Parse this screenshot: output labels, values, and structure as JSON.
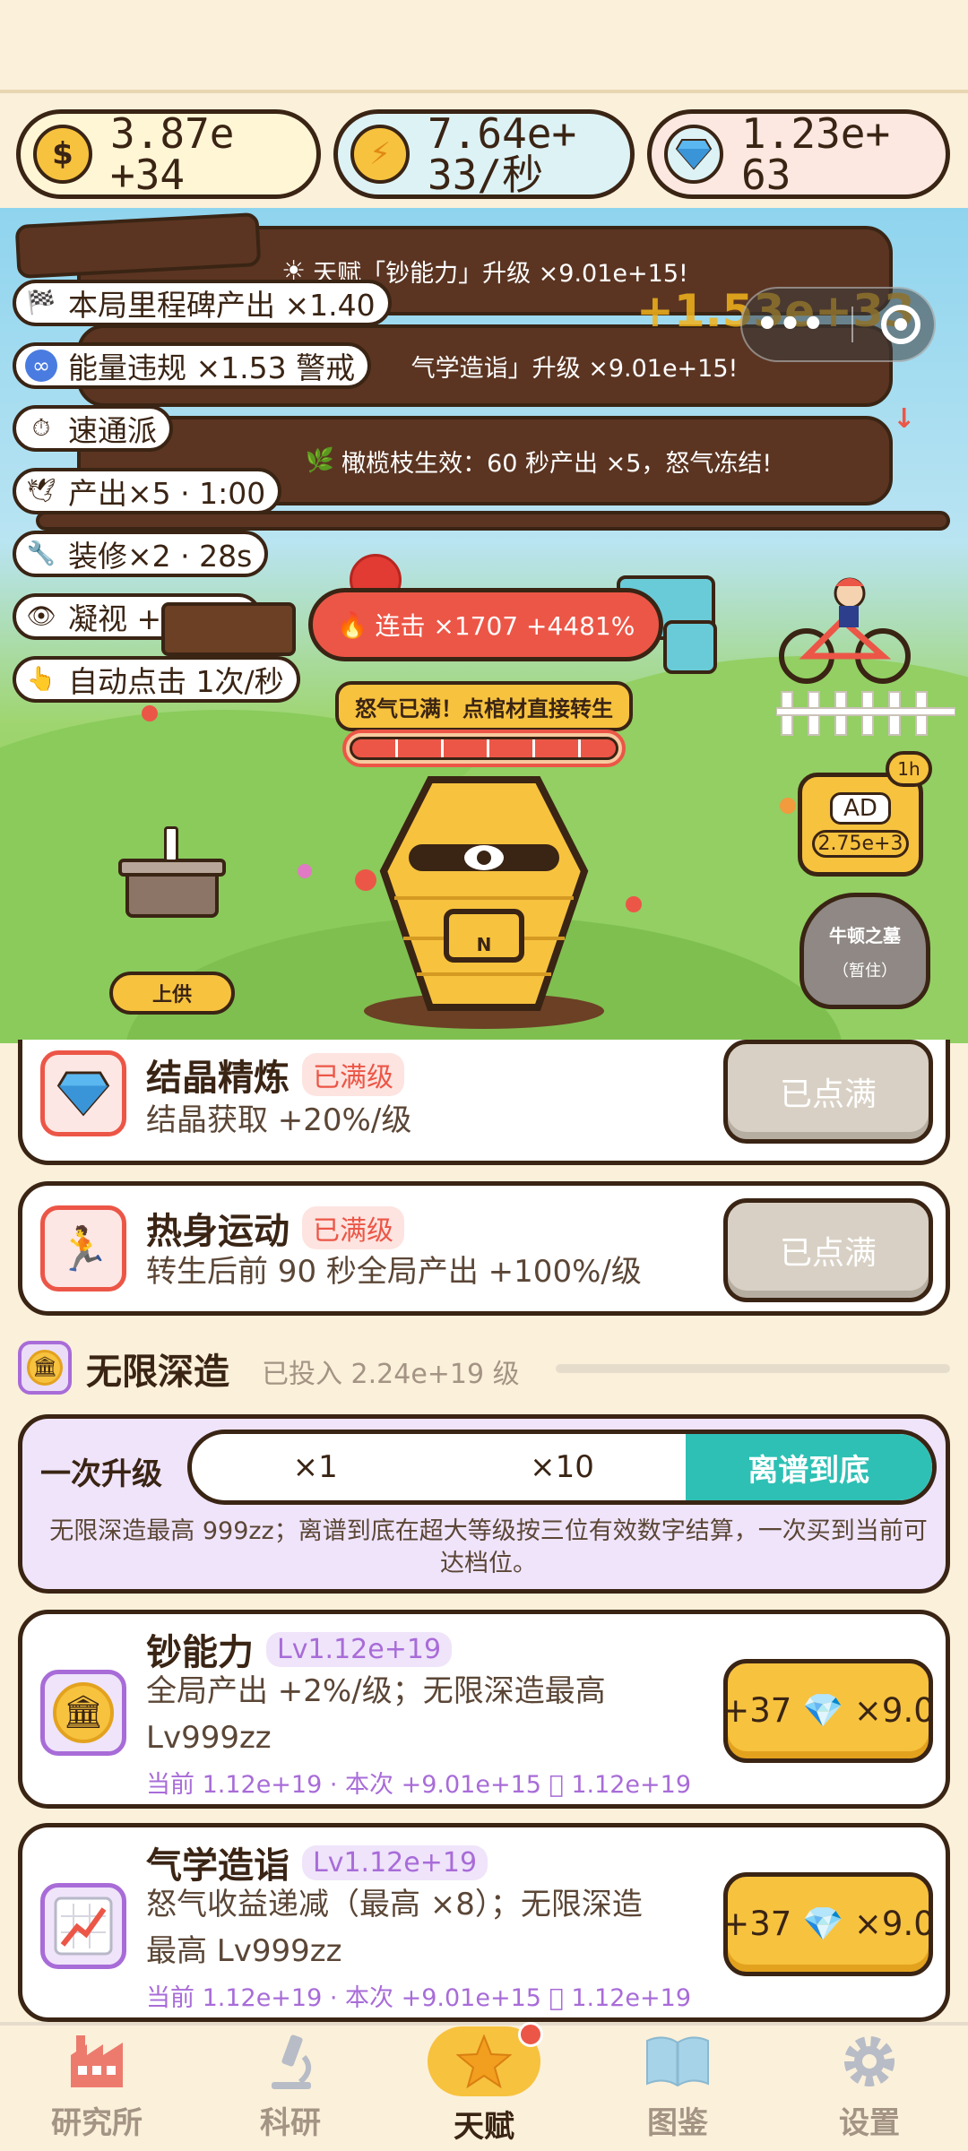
{
  "resources": [
    {
      "name": "money",
      "icon": "money-bag-icon",
      "value": "3.87e\n+34",
      "bg": "#FFF6D6"
    },
    {
      "name": "energy",
      "icon": "lightning-icon",
      "value": "7.64e+\n33/秒",
      "bg": "#DDF2F5"
    },
    {
      "name": "crystal",
      "icon": "diamond-icon",
      "value": "1.23e+\n63",
      "bg": "#FCE8E0"
    }
  ],
  "scene": {
    "banners": [
      "天赋「钞能力」升级 ×9.01e+15!",
      "气学造诣」升级 ×9.01e+15!",
      "橄榄枝生效：60 秒产出 ×5，怒气冻结!"
    ],
    "floating_gain": "+1.53e+33",
    "chips": [
      {
        "icon": "checkered-flag-icon",
        "text": "本局里程碑产出 ×1.40"
      },
      {
        "icon": "infinity-icon",
        "text": "能量违规 ×1.53 警戒"
      },
      {
        "icon": "stopwatch-icon",
        "text": "速通派"
      },
      {
        "icon": "dove-icon",
        "text": "产出×5 · 1:00"
      },
      {
        "icon": "wrench-icon",
        "text": "装修×2 · 28s"
      },
      {
        "icon": "eye-icon",
        "text": "凝视 +100%"
      },
      {
        "icon": "pointing-hand-icon",
        "text": "自动点击 1次/秒"
      }
    ],
    "combo": "连击 ×1707 +4481%",
    "rage_label": "怒气已满！点棺材直接转生",
    "rage_fill": 1.0,
    "offering_label": "上供",
    "coffin_plate": "N",
    "ad": {
      "label": "AD",
      "value": "2.75e+3",
      "timer": "1h"
    },
    "tomb": {
      "title": "牛顿之墓",
      "status": "（暂住）"
    }
  },
  "upgrades_top": [
    {
      "icon": "diamond-icon",
      "title": "结晶精炼",
      "tag": "已满级",
      "desc": "结晶获取 +20%/级",
      "button": "已点满"
    },
    {
      "icon": "runner-icon",
      "title": "热身运动",
      "tag": "已满级",
      "desc": "转生后前 90 秒全局产出 +100%/级",
      "button": "已点满"
    }
  ],
  "infinite": {
    "title": "无限深造",
    "invested": "已投入 2.24e+19 级",
    "buy_label": "一次升级",
    "options": [
      "×1",
      "×10",
      "离谱到底"
    ],
    "selected": 2,
    "note": "无限深造最高 999zz；离谱到底在超大等级按三位有效数字结算，一次买到当前可达档位。"
  },
  "upgrades_inf": [
    {
      "icon": "bank-icon",
      "title": "钞能力",
      "level": "Lv1.12e+19",
      "desc1": "全局产出 +2%/级；无限深造最高",
      "desc2": "Lv999zz",
      "sub": "当前 1.12e+19 · 本次 +9.01e+15 ⃞  1.12e+19",
      "cost": "+37 💎 ×9.0"
    },
    {
      "icon": "chart-icon",
      "title": "气学造诣",
      "level": "Lv1.12e+19",
      "desc1": "怒气收益递减（最高 ×8）；无限深造",
      "desc2": "最高 Lv999zz",
      "sub": "当前 1.12e+19 · 本次 +9.01e+15 ⃞  1.12e+19",
      "cost": "+37 💎 ×9.0"
    }
  ],
  "nav": [
    {
      "icon": "factory-icon",
      "label": "研究所"
    },
    {
      "icon": "microscope-icon",
      "label": "科研"
    },
    {
      "icon": "star-icon",
      "label": "天赋"
    },
    {
      "icon": "book-icon",
      "label": "图鉴"
    },
    {
      "icon": "gear-icon",
      "label": "设置"
    }
  ],
  "nav_active": 2,
  "colors": {
    "brown": "#3A2414",
    "teal": "#2EC0B5",
    "gold": "#F7C23E",
    "purple": "#A86CD8",
    "red": "#EC5647"
  }
}
